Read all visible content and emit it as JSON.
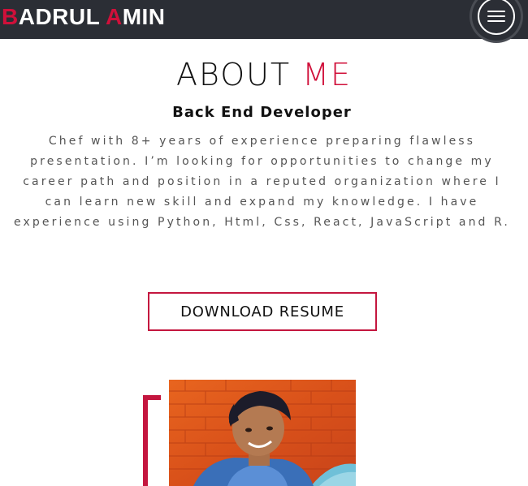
{
  "navbar": {
    "brand_first_initial": "B",
    "brand_first_rest": "ADRUL ",
    "brand_second_initial": "A",
    "brand_second_rest": "MIN",
    "menu_icon": "hamburger-menu-icon"
  },
  "about": {
    "title_part1": "ABOUT ",
    "title_part2": "ME",
    "subtitle": "Back End Developer",
    "bio": "Chef with 8+ years of experience preparing flawless presentation. I’m looking for opportunities to change my career path and position in a reputed organization where I can learn new skill and expand my knowledge. I have experience using Python, Html, Css, React, JavaScript and R.",
    "resume_button": "DOWNLOAD RESUME"
  },
  "colors": {
    "accent": "#d0103a",
    "navbar_bg": "#2b2e35",
    "button_border": "#c4163f"
  }
}
